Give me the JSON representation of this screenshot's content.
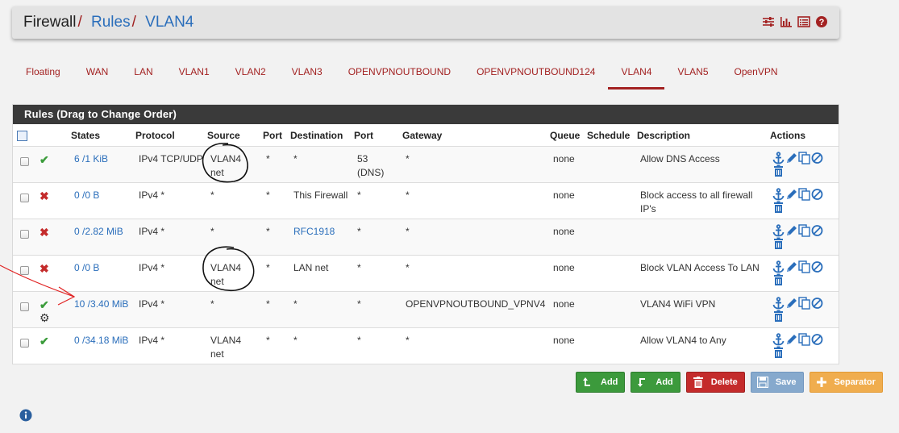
{
  "breadcrumb": {
    "items": [
      "Firewall",
      "Rules",
      "VLAN4"
    ],
    "separator": "/"
  },
  "header_icons": [
    "sliders-icon",
    "bar-chart-icon",
    "list-icon",
    "question-circle-icon"
  ],
  "tabs": [
    {
      "label": "Floating",
      "active": false
    },
    {
      "label": "WAN",
      "active": false
    },
    {
      "label": "LAN",
      "active": false
    },
    {
      "label": "VLAN1",
      "active": false
    },
    {
      "label": "VLAN2",
      "active": false
    },
    {
      "label": "VLAN3",
      "active": false
    },
    {
      "label": "OPENVPNOUTBOUND",
      "active": false
    },
    {
      "label": "OPENVPNOUTBOUND124",
      "active": false
    },
    {
      "label": "VLAN4",
      "active": true
    },
    {
      "label": "VLAN5",
      "active": false
    },
    {
      "label": "OpenVPN",
      "active": false
    }
  ],
  "panel": {
    "title": "Rules (Drag to Change Order)"
  },
  "columns": [
    "States",
    "Protocol",
    "Source",
    "Port",
    "Destination",
    "Port",
    "Gateway",
    "Queue",
    "Schedule",
    "Description",
    "Actions"
  ],
  "rules": [
    {
      "status": "pass",
      "states": "6 /1 KiB",
      "protocol": "IPv4 TCP/UDP",
      "source": "VLAN4 net",
      "src_port": "*",
      "destination": "*",
      "dest_link": false,
      "dst_port": "53 (DNS)",
      "gateway": "*",
      "queue": "none",
      "schedule": "",
      "description": "Allow DNS Access",
      "advanced": false
    },
    {
      "status": "block",
      "states": "0 /0 B",
      "protocol": "IPv4 *",
      "source": "*",
      "src_port": "*",
      "destination": "This Firewall",
      "dest_link": false,
      "dst_port": "*",
      "gateway": "*",
      "queue": "none",
      "schedule": "",
      "description": "Block access to all firewall IP's",
      "advanced": false
    },
    {
      "status": "block",
      "states": "0 /2.82 MiB",
      "protocol": "IPv4 *",
      "source": "*",
      "src_port": "*",
      "destination": "RFC1918",
      "dest_link": true,
      "dst_port": "*",
      "gateway": "*",
      "queue": "none",
      "schedule": "",
      "description": "",
      "advanced": false
    },
    {
      "status": "block",
      "states": "0 /0 B",
      "protocol": "IPv4 *",
      "source": "VLAN4 net",
      "src_port": "*",
      "destination": "LAN net",
      "dest_link": false,
      "dst_port": "*",
      "gateway": "*",
      "queue": "none",
      "schedule": "",
      "description": "Block VLAN Access To LAN",
      "advanced": false
    },
    {
      "status": "pass",
      "states": "10 /3.40 MiB",
      "protocol": "IPv4 *",
      "source": "*",
      "src_port": "*",
      "destination": "*",
      "dest_link": false,
      "dst_port": "*",
      "gateway": "OPENVPNOUTBOUND_VPNV4",
      "queue": "none",
      "schedule": "",
      "description": "VLAN4 WiFi VPN",
      "advanced": true
    },
    {
      "status": "pass",
      "states": "0 /34.18 MiB",
      "protocol": "IPv4 *",
      "source": "VLAN4 net",
      "src_port": "*",
      "destination": "*",
      "dest_link": false,
      "dst_port": "*",
      "gateway": "*",
      "queue": "none",
      "schedule": "",
      "description": "Allow VLAN4 to Any",
      "advanced": false
    }
  ],
  "row_actions": [
    "anchor-icon",
    "pencil-icon",
    "copy-icon",
    "disable-icon",
    "trash-icon"
  ],
  "buttons": {
    "add_top": "Add",
    "add_bottom": "Add",
    "delete": "Delete",
    "save": "Save",
    "separator": "Separator"
  },
  "colors": {
    "brand_red": "#a32222",
    "link_blue": "#2a6ebb",
    "pass_green": "#3b9c3b",
    "block_red": "#c42b2b",
    "annotation_red": "#e02020"
  }
}
